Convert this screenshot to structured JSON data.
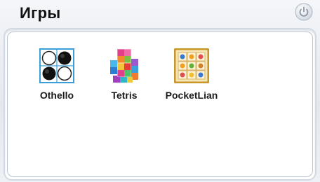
{
  "window": {
    "title": "Игры",
    "power_icon": "power-icon"
  },
  "games": [
    {
      "label": "Othello",
      "icon": "othello-icon"
    },
    {
      "label": "Tetris",
      "icon": "tetris-icon"
    },
    {
      "label": "PocketLian",
      "icon": "pocketlian-icon"
    }
  ],
  "colors": {
    "title_text": "#111111",
    "panel_border": "#d2d9e3",
    "icon_frame_gold": "#c8962a",
    "othello_board_border": "#3a9fd8"
  }
}
